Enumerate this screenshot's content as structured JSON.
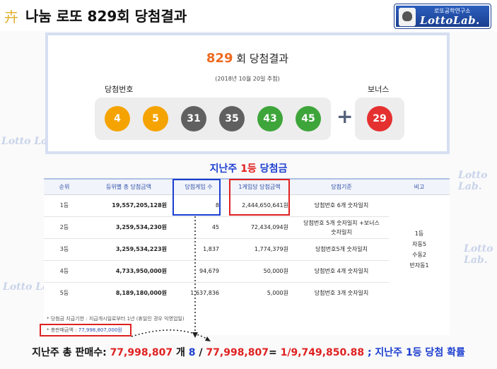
{
  "header": {
    "title": "나눔 로또 829회 당첨결과",
    "logo_glyph": "卉"
  },
  "brand": {
    "subtitle": "로또공학연구소",
    "name": "LottoLab."
  },
  "watermark": {
    "text": "Lotto Lab."
  },
  "result": {
    "round_number": "829",
    "round_suffix": "회 당첨결과",
    "draw_date": "(2018년 10월 20일 추첨)",
    "winning_label": "당첨번호",
    "bonus_label": "보너스",
    "plus": "+",
    "numbers": [
      "4",
      "5",
      "31",
      "35",
      "43",
      "45"
    ],
    "bonus": "29",
    "ball_colors": [
      "#f5a300",
      "#f5a300",
      "#606060",
      "#606060",
      "#3ea53a",
      "#3ea53a"
    ],
    "bonus_color": "#e53030"
  },
  "section": {
    "pre": "지난주 ",
    "highlight": "1등",
    "post": " 당첨금"
  },
  "table": {
    "headers": [
      "순위",
      "등위별 총 당첨금액",
      "당첨게임 수",
      "1게임당 당첨금액",
      "당첨기준",
      "비고"
    ],
    "rows": [
      {
        "rank": "1등",
        "total": "19,557,205,128원",
        "games": "8",
        "per_game": "2,444,650,641원",
        "criteria": "당첨번호 6개 숫자일치"
      },
      {
        "rank": "2등",
        "total": "3,259,534,230원",
        "games": "45",
        "per_game": "72,434,094원",
        "criteria": "당첨번호 5개 숫자일치 +보너스 숫자일치"
      },
      {
        "rank": "3등",
        "total": "3,259,534,223원",
        "games": "1,837",
        "per_game": "1,774,379원",
        "criteria": "당첨번호5개 숫자일치"
      },
      {
        "rank": "4등",
        "total": "4,733,950,000원",
        "games": "94,679",
        "per_game": "50,000원",
        "criteria": "당첨번호 4개 숫자일치"
      },
      {
        "rank": "5등",
        "total": "8,189,180,000원",
        "games": "1,637,836",
        "per_game": "5,000원",
        "criteria": "당첨번호 3개 숫자일치"
      }
    ],
    "note_lines": [
      "1등",
      "자동5",
      "수동2",
      "반자동1"
    ]
  },
  "notes": {
    "line1": "* 당첨금 지급기한 : 지급개시일로부터 1년 (휴일인 경우 익영업일)",
    "line2_label": "* 총판매금액 : ",
    "line2_value": "77,998,807,000원"
  },
  "formula": {
    "lead": "지난주 총 판매수: ",
    "sales": "77,998,807",
    "unit": " 개 ",
    "winners": "8",
    "slash": " / ",
    "sales2": "77,998,807",
    "equals": "=  ",
    "result": "1/9,749,850.88",
    "tail": " ; 지난주 1등 당첨 확률"
  }
}
